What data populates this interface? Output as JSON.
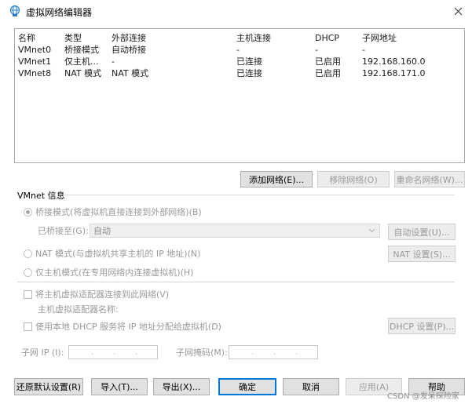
{
  "window": {
    "title": "虚拟网络编辑器",
    "app_icon": "network-globe-icon",
    "close_icon": "close-icon"
  },
  "network_table": {
    "columns": [
      "名称",
      "类型",
      "外部连接",
      "主机连接",
      "DHCP",
      "子网地址"
    ],
    "rows": [
      [
        "VMnet0",
        "桥接模式",
        "自动桥接",
        "-",
        "-",
        "-"
      ],
      [
        "VMnet1",
        "仅主机...",
        "-",
        "已连接",
        "已启用",
        "192.168.160.0"
      ],
      [
        "VMnet8",
        "NAT 模式",
        "NAT 模式",
        "已连接",
        "已启用",
        "192.168.171.0"
      ]
    ]
  },
  "list_buttons": {
    "add": "添加网络(E)...",
    "remove": "移除网络(O)",
    "rename": "重命名网络(W)..."
  },
  "vmnet_info": {
    "group_label": "VMnet 信息",
    "bridged_label": "桥接模式(将虚拟机直接连接到外部网络)(B)",
    "bridged_to_label": "已桥接至(G):",
    "bridged_to_value": "自动",
    "auto_settings": "自动设置(U)...",
    "nat_label": "NAT 模式(与虚拟机共享主机的 IP 地址)(N)",
    "nat_settings": "NAT 设置(S)...",
    "hostonly_label": "仅主机模式(在专用网络内连接虚拟机)(H)",
    "connect_adapter_label": "将主机虚拟适配器连接到此网络(V)",
    "adapter_name_label": "主机虚拟适配器名称:",
    "dhcp_label": "使用本地 DHCP 服务将 IP 地址分配给虚拟机(D)",
    "dhcp_settings": "DHCP 设置(P)...",
    "subnet_ip_label": "子网 IP (I):",
    "subnet_mask_label": "子网掩码(M):",
    "ip_dot": "."
  },
  "bottom_buttons": {
    "restore": "还原默认设置(R)",
    "import": "导入(T)...",
    "export": "导出(X)...",
    "ok": "确定",
    "cancel": "取消",
    "apply": "应用(A)",
    "help": "帮助"
  },
  "watermark": "CSDN @发呆探险家"
}
